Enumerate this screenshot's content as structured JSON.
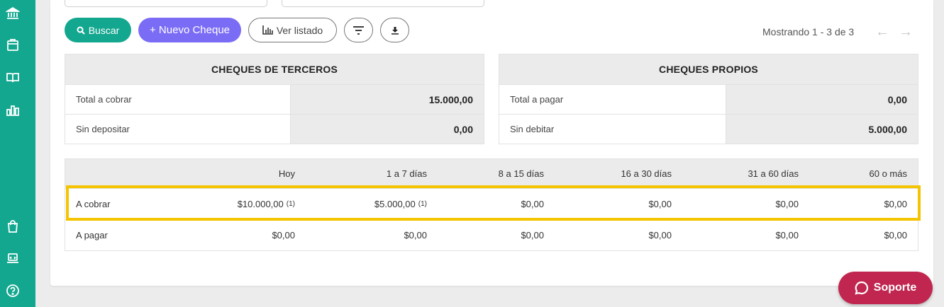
{
  "sidebar": {
    "icons": [
      "bank-icon",
      "register-icon",
      "book-icon",
      "bar-chart-icon",
      "shopping-bag-icon",
      "laptop-icon",
      "help-icon"
    ]
  },
  "toolbar": {
    "search_label": "Buscar",
    "new_check_label": "+ Nuevo Cheque",
    "view_list_label": "Ver listado"
  },
  "pagination": {
    "text": "Mostrando 1 - 3 de 3",
    "prev": "←",
    "next": "→"
  },
  "third_party": {
    "title": "CHEQUES DE TERCEROS",
    "rows": [
      {
        "label": "Total a cobrar",
        "value": "15.000,00"
      },
      {
        "label": "Sin depositar",
        "value": "0,00"
      }
    ]
  },
  "own": {
    "title": "CHEQUES PROPIOS",
    "rows": [
      {
        "label": "Total a pagar",
        "value": "0,00"
      },
      {
        "label": "Sin debitar",
        "value": "5.000,00"
      }
    ]
  },
  "aging": {
    "headers": [
      "Hoy",
      "1 a 7 días",
      "8 a 15 días",
      "16 a 30 días",
      "31 a 60 días",
      "60 o más"
    ],
    "rows": [
      {
        "label": "A cobrar",
        "cells": [
          {
            "value": "$10.000,00",
            "count": "(1)"
          },
          {
            "value": "$5.000,00",
            "count": "(1)"
          },
          {
            "value": "$0,00",
            "count": ""
          },
          {
            "value": "$0,00",
            "count": ""
          },
          {
            "value": "$0,00",
            "count": ""
          },
          {
            "value": "$0,00",
            "count": ""
          }
        ]
      },
      {
        "label": "A pagar",
        "cells": [
          {
            "value": "$0,00",
            "count": ""
          },
          {
            "value": "$0,00",
            "count": ""
          },
          {
            "value": "$0,00",
            "count": ""
          },
          {
            "value": "$0,00",
            "count": ""
          },
          {
            "value": "$0,00",
            "count": ""
          },
          {
            "value": "$0,00",
            "count": ""
          }
        ]
      }
    ]
  },
  "support": {
    "label": "Soporte"
  },
  "colors": {
    "sidebar": "#14a78f",
    "primary": "#7b6cf6",
    "highlight": "#f5c400",
    "support": "#c0264f"
  }
}
